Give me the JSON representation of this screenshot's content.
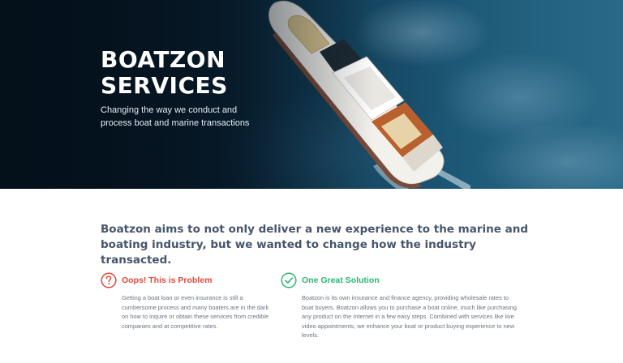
{
  "hero": {
    "title_line1": "BOATZON",
    "title_line2": "SERVICES",
    "subtitle": "Changing the way we conduct and process boat and marine transactions"
  },
  "intro": {
    "text": "Boatzon aims to not only deliver a new experience to the marine and boating industry, but we wanted to change how the industry transacted."
  },
  "features": {
    "problem": {
      "icon": "question-circle-icon",
      "title": "Oops! This is Problem",
      "text": "Getting a boat loan or even insurance is still a cumbersome process and many boaters are in the dark on how to inquire or obtain these services from credible companies and at competitive rates.",
      "color": "#e2473b"
    },
    "solution": {
      "icon": "check-circle-icon",
      "title": "One Great Solution",
      "text": "Boatzon is its own insurance and finance agency, providing wholesale rates to boat buyers. Boatzon allows you to purchase a boat online, much like purchasing any product on the Internet in a few easy steps. Combined with services like live video appointments, we enhance your boat or product buying experience to new levels.",
      "color": "#2bb673"
    }
  },
  "colors": {
    "hero_dark": "#061724",
    "text_heading": "#47566b",
    "text_body": "#6a7482"
  }
}
